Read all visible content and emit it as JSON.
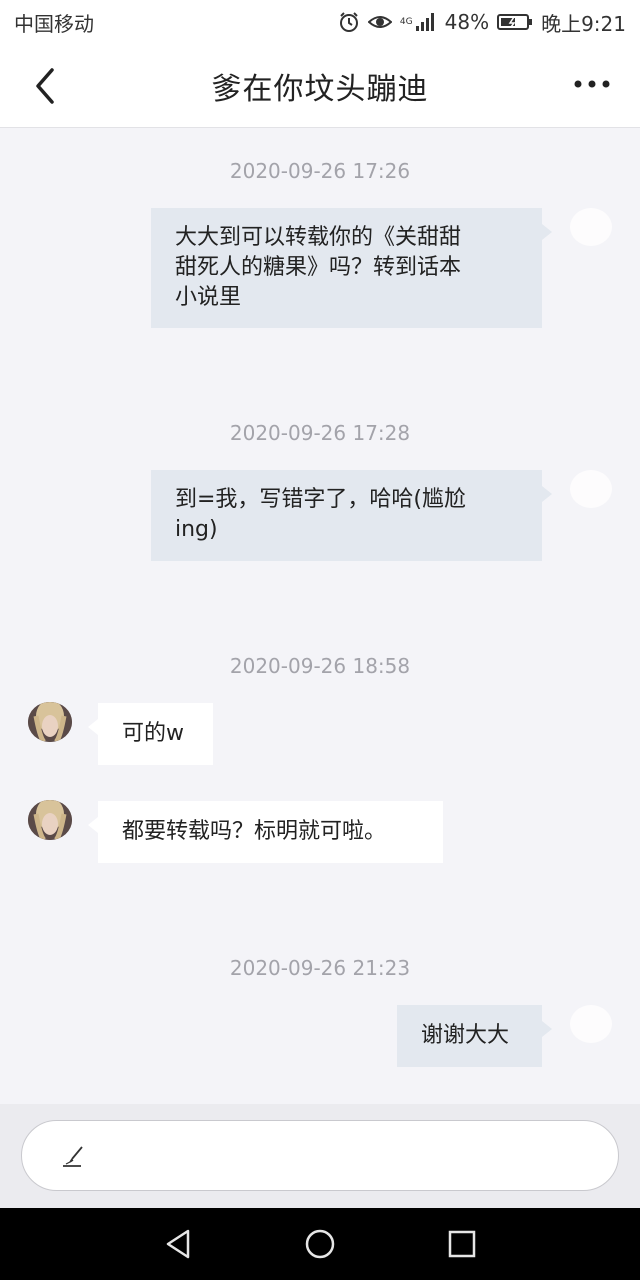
{
  "status_bar": {
    "carrier": "中国移动",
    "network": "4G",
    "battery": "48%",
    "time": "晚上9:21",
    "icons": [
      "alarm-icon",
      "eye-icon",
      "signal-icon",
      "battery-icon"
    ]
  },
  "header": {
    "title": "爹在你坟头蹦迪",
    "back_icon": "chevron-left-icon",
    "more_icon": "more-dots-icon"
  },
  "messages": [
    {
      "timestamp": "2020-09-26 17:26"
    },
    {
      "direction": "out",
      "lines": [
        "大大到可以转载你的《关甜甜",
        "甜死人的糖果》吗？转到话本",
        "小说里"
      ]
    },
    {
      "timestamp": "2020-09-26 17:28"
    },
    {
      "direction": "out",
      "lines": [
        "到=我，写错字了，哈哈(尴尬",
        "ing)"
      ]
    },
    {
      "timestamp": "2020-09-26 18:58"
    },
    {
      "direction": "in",
      "text": "可的w"
    },
    {
      "direction": "in",
      "text": "都要转载吗？标明就可啦。"
    },
    {
      "timestamp": "2020-09-26 21:23"
    },
    {
      "direction": "out",
      "text": "谢谢大大"
    }
  ],
  "composer": {
    "placeholder": "",
    "value": "",
    "icon": "pen-icon"
  },
  "system_nav": {
    "back": "back-triangle-icon",
    "home": "home-circle-icon",
    "recents": "recents-square-icon"
  },
  "colors": {
    "chat_background": "#f4f4f8",
    "outgoing_bubble": "#e3e8ef",
    "incoming_bubble": "#ffffff",
    "timestamp_text": "#a3a3aa"
  }
}
